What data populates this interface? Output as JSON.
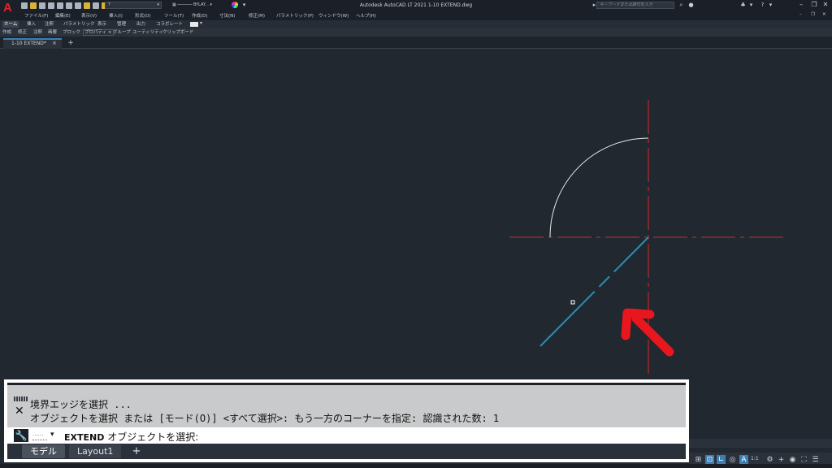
{
  "app": {
    "title": "Autodesk AutoCAD LT 2021    1-10 EXTEND.dwg",
    "logo_letter": "A",
    "search_placeholder": "キーワードまたは語句を入力",
    "layer_value": "?",
    "linetype_value": "BYLAY...",
    "accent_color": "#3c7fb1",
    "brand_color": "#d8282c"
  },
  "menu": {
    "items": [
      "ファイル(F)",
      "編集(E)",
      "表示(V)",
      "挿入(I)",
      "形式(O)",
      "ツール(T)",
      "作成(D)",
      "寸法(N)",
      "修正(M)",
      "パラメトリック(P)",
      "ウィンドウ(W)",
      "ヘルプ(H)"
    ]
  },
  "ribbon": {
    "tabs": [
      "ホーム",
      "挿入",
      "注釈",
      "パラメトリック",
      "表示",
      "管理",
      "出力",
      "コラボレート"
    ],
    "panels": [
      "作成",
      "修正",
      "注釈",
      "画層",
      "ブロック",
      "プロパティ",
      "グループ",
      "ユーティリティ",
      "クリップボード"
    ]
  },
  "file_tab": {
    "label": "1-10 EXTEND*",
    "close": "×",
    "new": "+"
  },
  "command": {
    "history": [
      "境界エッジを選択 ...",
      "オブジェクトを選択 または [モード(O)] <すべて選択>: もう一方のコーナーを指定: 認識された数: 1"
    ],
    "prompt_command": "EXTEND",
    "prompt_text": "オブジェクトを選択:",
    "recent_label": "......",
    "close_glyph": "✕"
  },
  "layout_tabs": {
    "items": [
      "モデル",
      "Layout1"
    ],
    "add": "+"
  },
  "status": {
    "scale": "1:1"
  },
  "icons": {
    "title_bar": [
      "new-icon",
      "open-icon",
      "save-icon",
      "saveas-icon",
      "print-icon",
      "undo-icon",
      "redo-icon",
      "user-icon",
      "cart-icon",
      "help-icon"
    ],
    "status_bar": [
      "grid-icon",
      "snap-icon",
      "ortho-icon",
      "polar-icon",
      "osnap-icon",
      "annotation-icon",
      "gear-icon",
      "plus-icon",
      "isolate-icon",
      "fullscreen-icon",
      "menu-icon"
    ]
  }
}
